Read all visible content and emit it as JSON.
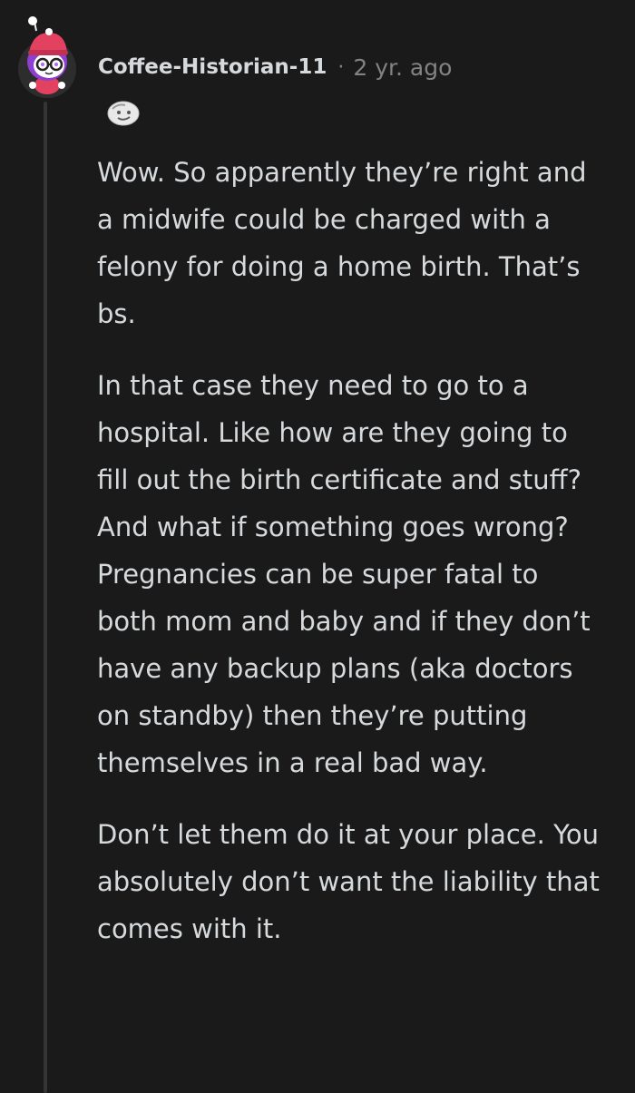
{
  "comment": {
    "author": "Coffee-Historian-11",
    "separator": "·",
    "time": "2 yr. ago",
    "paragraphs": [
      "Wow. So apparently they’re right and a midwife could be charged with a felony for doing a home birth. That’s bs.",
      "In that case they need to go to a hospital. Like how are they going to fill out the birth certificate and stuff? And what if something goes wrong? Pregnancies can be super fatal to both mom and baby and if they don’t have any backup plans (aka doctors on standby) then they’re putting themselves in a real bad way.",
      "Don’t let them do it at your place. You absolutely don’t want the liability that comes with it."
    ]
  },
  "icons": {
    "avatar": "snoo-avatar-icon",
    "flair": "flair-emoji-icon"
  },
  "colors": {
    "background": "#1a1a1b",
    "text": "#d7dadc",
    "muted": "#818384",
    "thread_line": "#343536",
    "avatar_purple": "#8e3fd1",
    "avatar_pink": "#e2415f"
  }
}
